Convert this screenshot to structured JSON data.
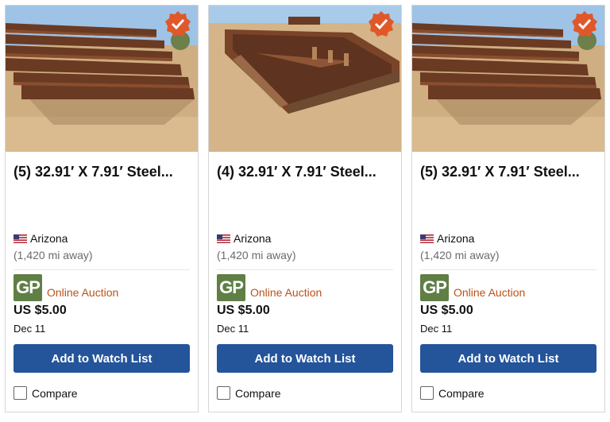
{
  "listings": [
    {
      "title": "(5) 32.91′ X 7.91′ Steel...",
      "location": "Arizona",
      "distance": "(1,420 mi away)",
      "seller_logo": "GP",
      "auction_type": "Online Auction",
      "price": "US $5.00",
      "date": "Dec 11",
      "watch_label": "Add to Watch List",
      "compare_label": "Compare"
    },
    {
      "title": "(4) 32.91′ X 7.91′ Steel...",
      "location": "Arizona",
      "distance": "(1,420 mi away)",
      "seller_logo": "GP",
      "auction_type": "Online Auction",
      "price": "US $5.00",
      "date": "Dec 11",
      "watch_label": "Add to Watch List",
      "compare_label": "Compare"
    },
    {
      "title": "(5) 32.91′ X 7.91′ Steel...",
      "location": "Arizona",
      "distance": "(1,420 mi away)",
      "seller_logo": "GP",
      "auction_type": "Online Auction",
      "price": "US $5.00",
      "date": "Dec 11",
      "watch_label": "Add to Watch List",
      "compare_label": "Compare"
    }
  ],
  "colors": {
    "button": "#24549a",
    "auction_text": "#b8521a",
    "badge": "#e0582a",
    "logo_bg": "#5f7f45"
  }
}
